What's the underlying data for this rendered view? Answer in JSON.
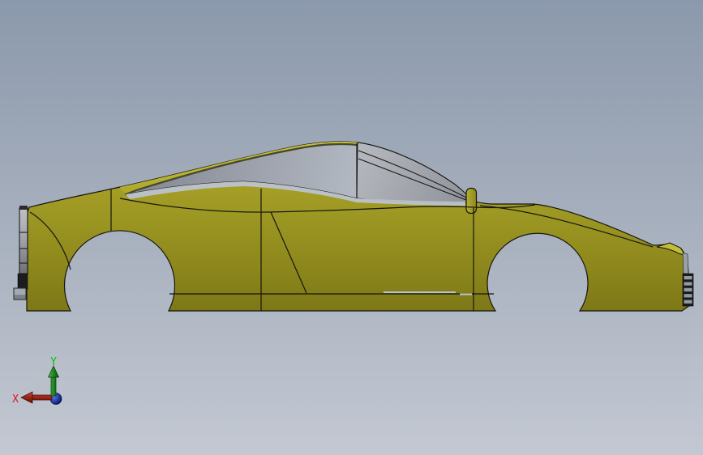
{
  "scene": {
    "type": "cad-viewport",
    "subject": "sports-car body shell, left side view"
  },
  "triad": {
    "x_label": "X",
    "y_label": "Y"
  },
  "colors": {
    "background_top": "#8b99ac",
    "background_mid": "#a6afbd",
    "background_bottom": "#c3c8d2",
    "car_body": "#9a9422",
    "car_body_light": "#b7b130",
    "car_body_dark": "#7b7616",
    "roof_highlight": "#cbc63e",
    "roof_sliver": "#6f6a15",
    "glass_dark": "#858994",
    "glass_light": "#b2b8c1",
    "canopy_light": "#b4b7be",
    "canopy_dark": "#8f929a",
    "gap_strip": "#bcc3ce",
    "outline": "#16160f",
    "grille_gray": "#9fa1a6",
    "detail_dark": "#1b1c1e",
    "detail_gray": "#969ba3",
    "axis_x": "#a02717",
    "axis_y": "#1f8a1f",
    "axis_z": "#2742b0",
    "label_x": "#e01414",
    "label_y": "#00c800",
    "triad_disc": "#b9bfc9"
  }
}
